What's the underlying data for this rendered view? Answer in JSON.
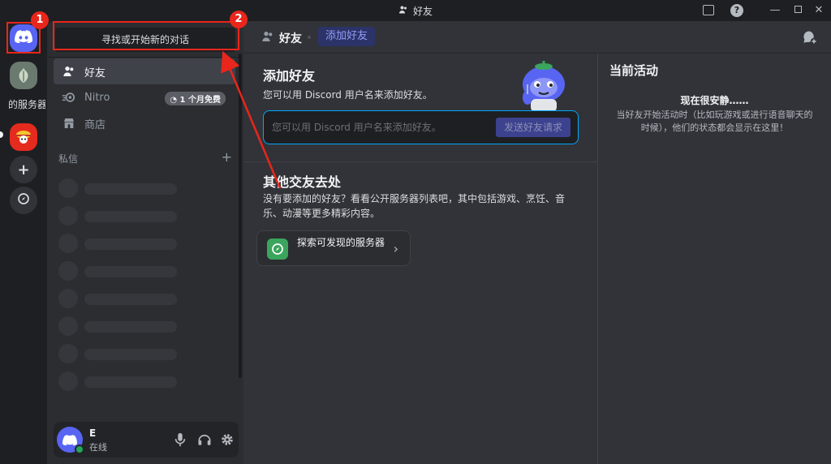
{
  "window": {
    "title": "好友"
  },
  "rail": {
    "server_label": "的服务器"
  },
  "sidebar": {
    "search_label": "寻找或开始新的对话",
    "nav": [
      {
        "label": "好友"
      },
      {
        "label": "Nitro",
        "badge": "1 个月免费"
      },
      {
        "label": "商店"
      }
    ],
    "dm_header": "私信",
    "dm_add": "+"
  },
  "user": {
    "name": "E",
    "status": "在线"
  },
  "header": {
    "title": "好友",
    "tab_add": "添加好友"
  },
  "add_friend": {
    "title": "添加好友",
    "subtitle": "您可以用 Discord 用户名来添加好友。",
    "input_placeholder": "您可以用 Discord 用户名来添加好友。",
    "send_button": "发送好友请求"
  },
  "other": {
    "title": "其他交友去处",
    "description": "没有要添加的好友？看看公开服务器列表吧，其中包括游戏、烹饪、音乐、动漫等更多精彩内容。",
    "explore_button": "探索可发现的服务器"
  },
  "activity": {
    "title": "当前活动",
    "quiet": "现在很安静……",
    "description": "当好友开始活动时（比如玩游戏或进行语音聊天的时候），他们的状态都会显示在这里！"
  },
  "annotations": {
    "one": "1",
    "two": "2"
  },
  "colors": {
    "accent": "#5865f2",
    "annotation": "#e8261c",
    "online": "#23a55a",
    "input_focus": "#00a8fc"
  }
}
